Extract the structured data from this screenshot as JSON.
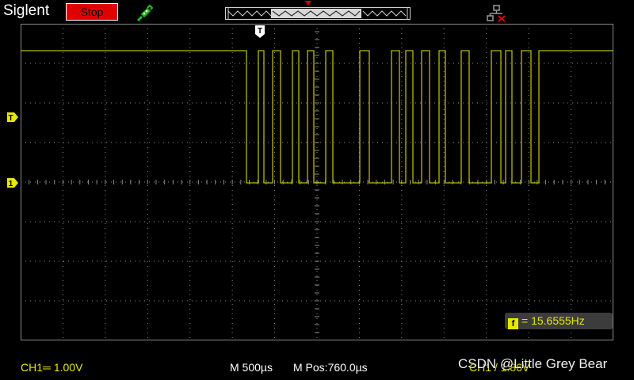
{
  "header": {
    "brand": "Siglent",
    "run_state": "Stop",
    "icons": [
      "probe-icon",
      "memory-position-icon",
      "trigger-position-icon",
      "network-disconnected-icon"
    ]
  },
  "markers": {
    "trigger_level": "T",
    "channel1_ground": "1",
    "trigger_time": "T"
  },
  "measurement": {
    "icon_label": "f",
    "text": "= 15.6555Hz"
  },
  "footer": {
    "ch1_scale": "CH1═ 1.00V",
    "timebase": "M 500µs",
    "h_position": "M Pos:760.0µs",
    "trigger": "CH1 / 1.86V",
    "watermark": "CSDN @Little Grey Bear"
  },
  "colors": {
    "grid": "#8a8a8a",
    "trace": "#b8b800",
    "accent_yellow": "#e8e800",
    "stop_red": "#e00000"
  }
}
